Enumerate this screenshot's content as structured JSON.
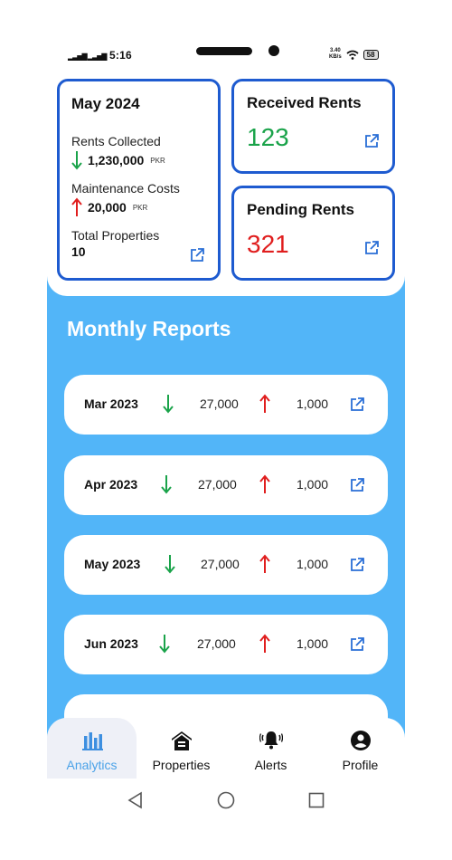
{
  "status_bar": {
    "time": "5:16",
    "speed_value": "3.40",
    "speed_unit": "KB/s",
    "battery": "58"
  },
  "summary_card": {
    "title": "May 2024",
    "rents_collected_label": "Rents Collected",
    "rents_collected_value": "1,230,000",
    "rents_collected_unit": "PKR",
    "maintenance_label": "Maintenance Costs",
    "maintenance_value": "20,000",
    "maintenance_unit": "PKR",
    "total_properties_label": "Total Properties",
    "total_properties_value": "10"
  },
  "received_card": {
    "title": "Received Rents",
    "value": "123",
    "color": "#1aa34a"
  },
  "pending_card": {
    "title": "Pending Rents",
    "value": "321",
    "color": "#e01e1e"
  },
  "monthly_reports": {
    "title": "Monthly Reports",
    "rows": [
      {
        "month": "Mar 2023",
        "income": "27,000",
        "expense": "1,000"
      },
      {
        "month": "Apr 2023",
        "income": "27,000",
        "expense": "1,000"
      },
      {
        "month": "May 2023",
        "income": "27,000",
        "expense": "1,000"
      },
      {
        "month": "Jun 2023",
        "income": "27,000",
        "expense": "1,000"
      }
    ]
  },
  "bottom_nav": {
    "items": [
      {
        "label": "Analytics",
        "icon": "bar-chart-icon",
        "active": true
      },
      {
        "label": "Properties",
        "icon": "house-icon",
        "active": false
      },
      {
        "label": "Alerts",
        "icon": "bell-icon",
        "active": false
      },
      {
        "label": "Profile",
        "icon": "user-circle-icon",
        "active": false
      }
    ]
  },
  "colors": {
    "accent_blue": "#52b5f8",
    "card_border": "#1e5bd0",
    "nav_active": "#4aa2e8"
  }
}
